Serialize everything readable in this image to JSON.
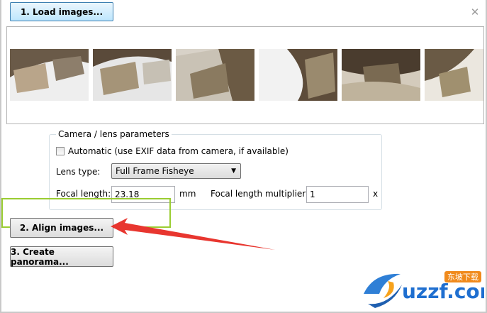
{
  "toolbar": {
    "load_label": "1. Load images..."
  },
  "thumbnails": [
    {
      "name": "photo-1"
    },
    {
      "name": "photo-2"
    },
    {
      "name": "photo-3"
    },
    {
      "name": "photo-4"
    },
    {
      "name": "photo-5"
    },
    {
      "name": "photo-6"
    }
  ],
  "params": {
    "title": "Camera / lens parameters",
    "automatic_label": "Automatic (use EXIF data from camera, if available)",
    "automatic_checked": false,
    "lens_type_label": "Lens type:",
    "lens_type_value": "Full Frame Fisheye",
    "focal_length_label": "Focal length:",
    "focal_length_value": "23.18",
    "focal_length_unit": "mm",
    "multiplier_label": "Focal length multiplier:",
    "multiplier_value": "1",
    "multiplier_unit": "x"
  },
  "actions": {
    "align_label": "2. Align images...",
    "create_label": "3. Create panorama..."
  },
  "watermark": {
    "text": "uzzf.com",
    "subtext": "东坡下载"
  },
  "colors": {
    "highlight": "#9acd32",
    "arrow": "#e8362f",
    "accent": "#3c7fb1"
  }
}
